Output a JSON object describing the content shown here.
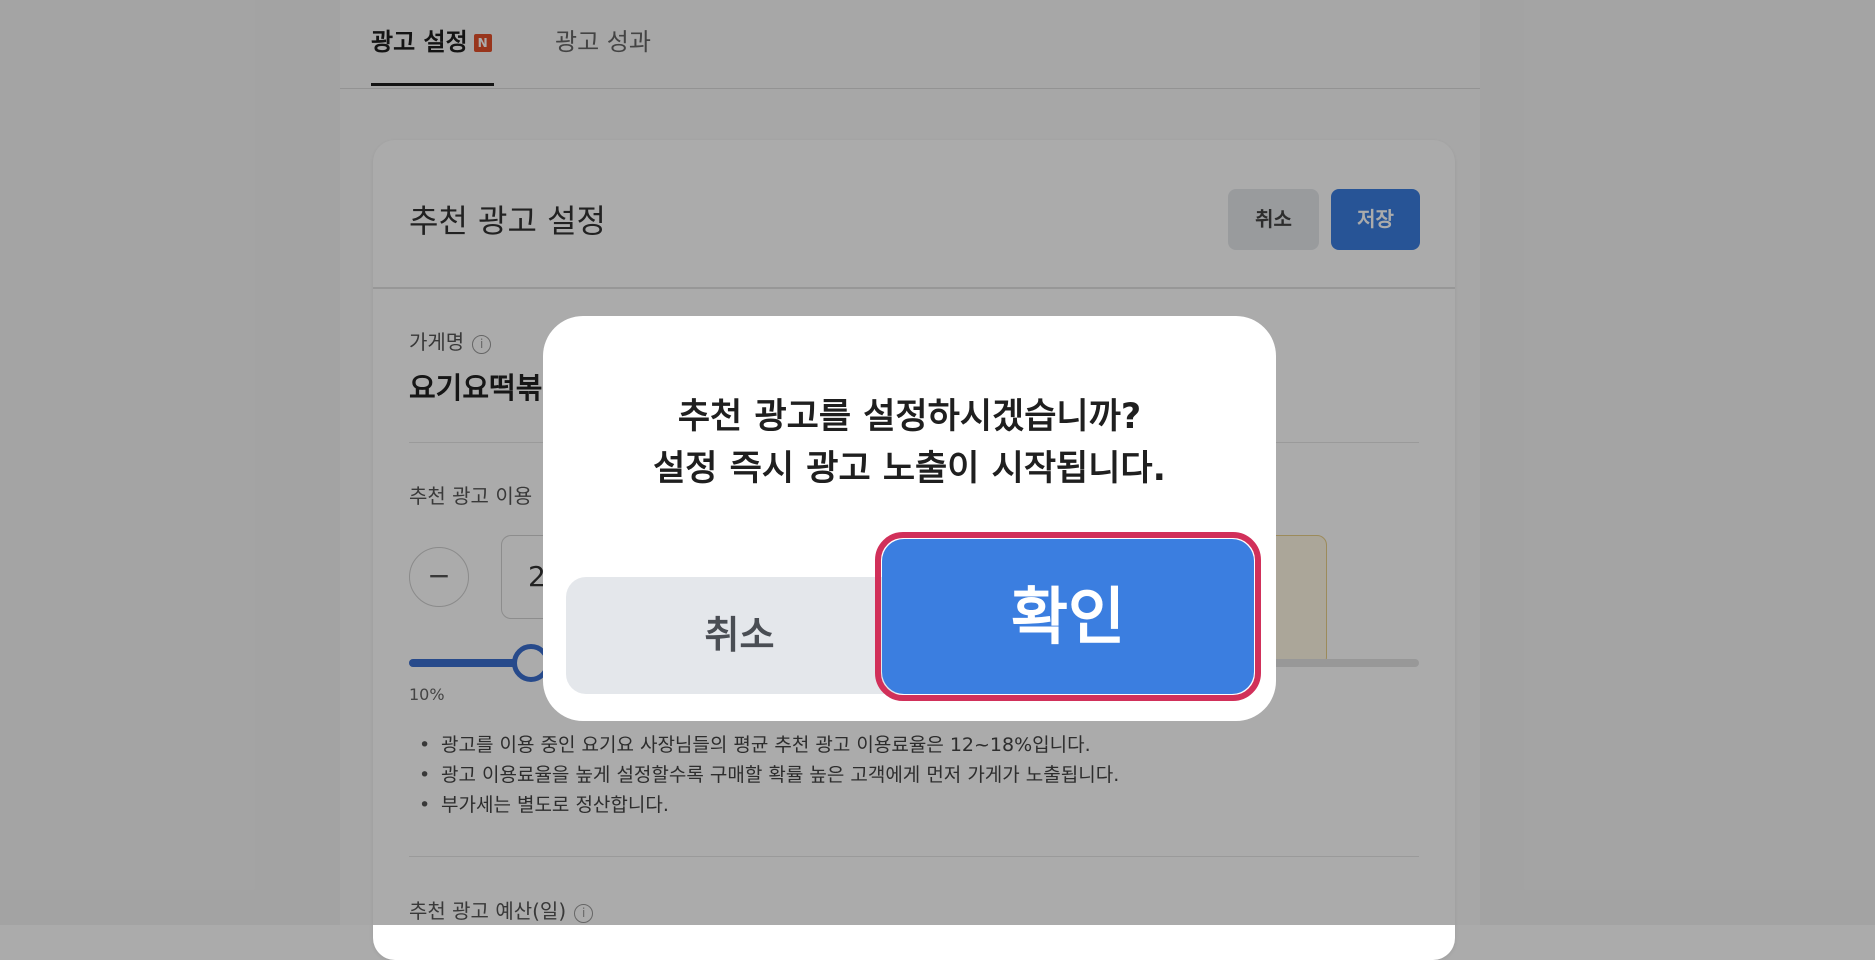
{
  "tabs": [
    {
      "label": "광고 설정",
      "badge": "N",
      "active": true
    },
    {
      "label": "광고 성과",
      "active": false
    }
  ],
  "card": {
    "title": "추천 광고 설정",
    "cancel_label": "취소",
    "save_label": "저장"
  },
  "store": {
    "label": "가게명",
    "name": "요기요떡볶"
  },
  "rate": {
    "label": "추천 광고 이용",
    "minus_symbol": "−",
    "value_partial": "2",
    "slider_min": "10%"
  },
  "notes": [
    "광고를 이용 중인 요기요 사장님들의 평균 추천 광고 이용료율은 12~18%입니다.",
    "광고 이용료율을 높게 설정할수록 구매할 확률 높은 고객에게 먼저 가게가 노출됩니다.",
    "부가세는 별도로 정산합니다."
  ],
  "budget": {
    "label": "추천 광고 예산(일)"
  },
  "modal": {
    "message": "추천 광고를 설정하시겠습니까?\n설정 즉시 광고 노출이 시작됩니다.",
    "cancel_label": "취소",
    "confirm_label": "확인"
  },
  "colors": {
    "primary": "#3b7ee0",
    "highlight": "#d1305a",
    "badge": "#e3502a"
  },
  "icons": {
    "info": "info-icon",
    "minus": "minus-icon"
  }
}
